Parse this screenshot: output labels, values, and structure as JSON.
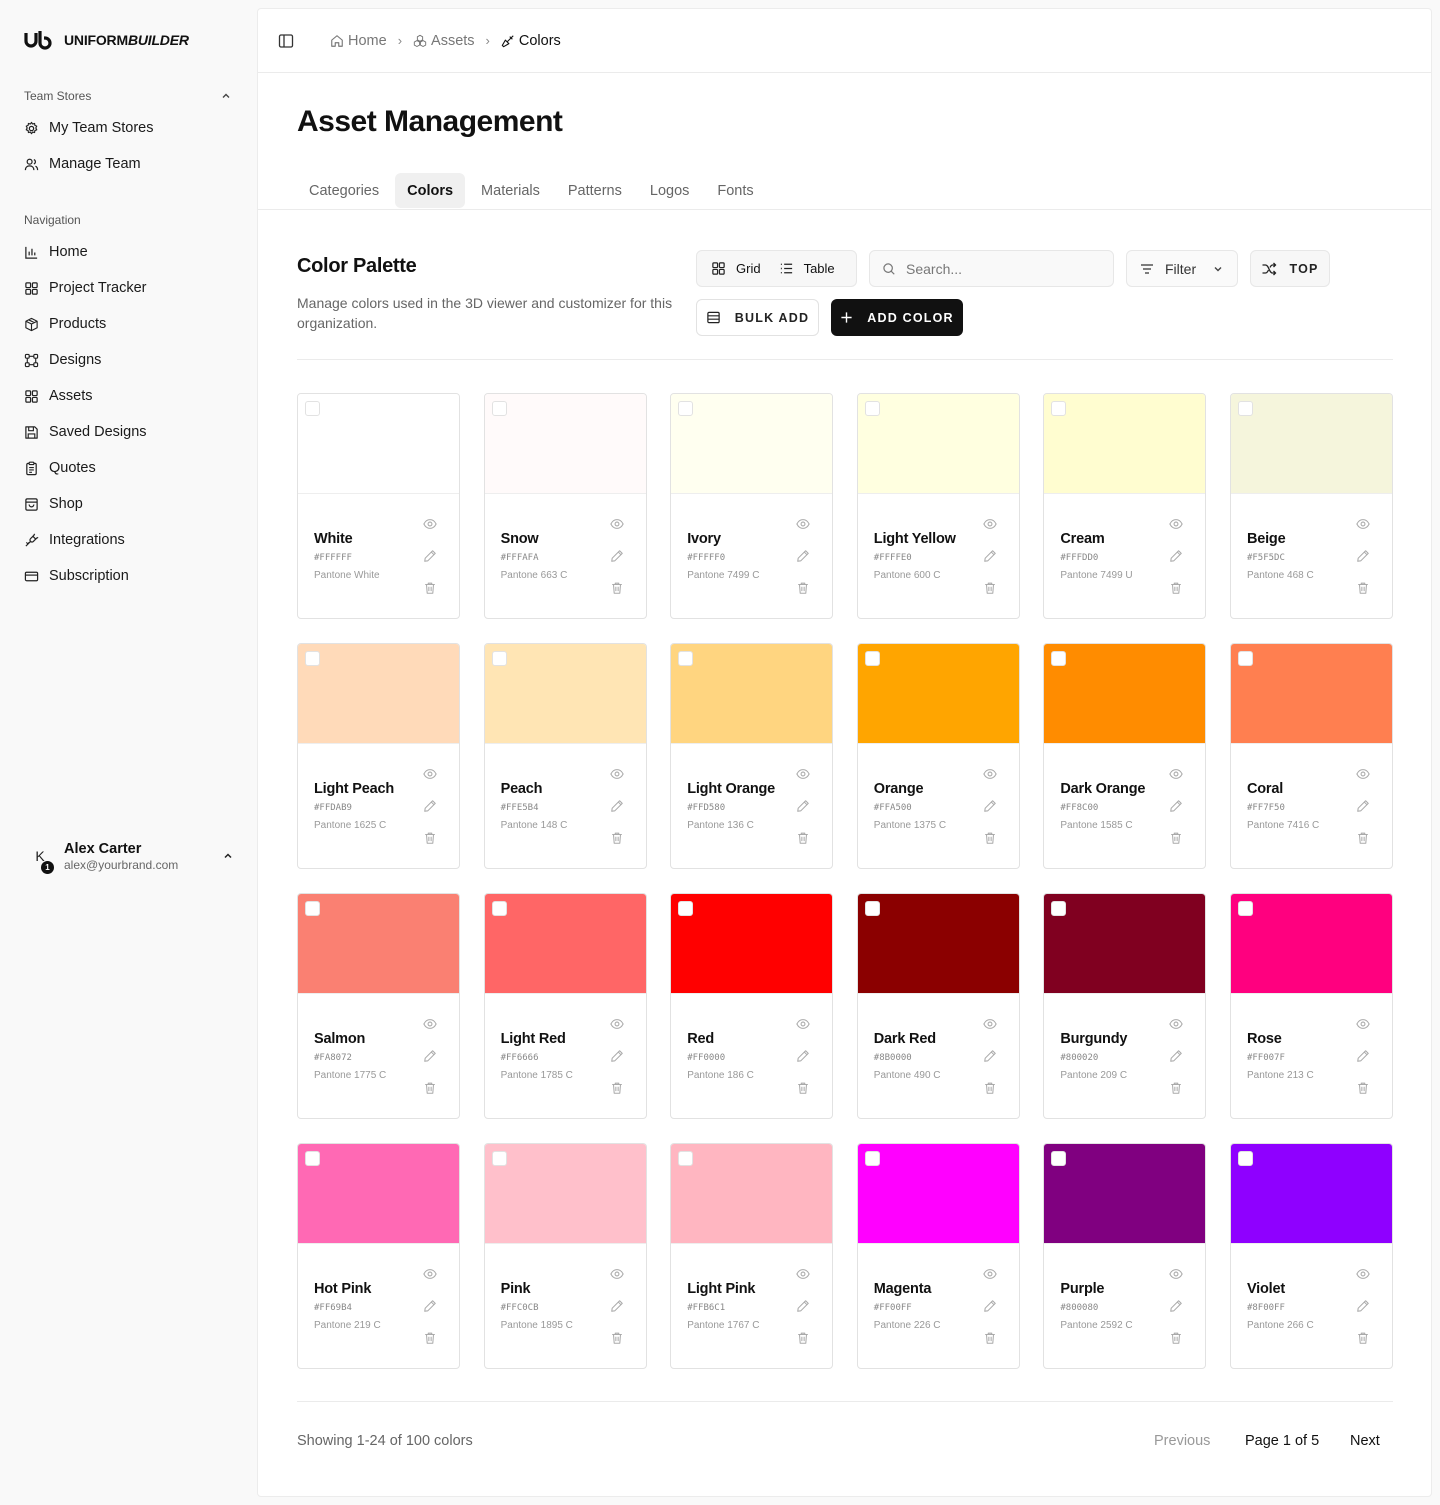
{
  "brand": {
    "logo_text_a": "UNIFORM",
    "logo_text_b": "BUILDER"
  },
  "sidebar": {
    "team_group": "Team Stores",
    "team_items": [
      {
        "label": "My Team Stores",
        "icon": "gear-icon"
      },
      {
        "label": "Manage Team",
        "icon": "users-icon"
      }
    ],
    "nav_group": "Navigation",
    "nav_items": [
      {
        "label": "Home",
        "icon": "chart-icon"
      },
      {
        "label": "Project Tracker",
        "icon": "grid-icon"
      },
      {
        "label": "Products",
        "icon": "box-icon"
      },
      {
        "label": "Designs",
        "icon": "nodes-icon"
      },
      {
        "label": "Assets",
        "icon": "grid-icon"
      },
      {
        "label": "Saved Designs",
        "icon": "save-icon"
      },
      {
        "label": "Quotes",
        "icon": "clipboard-icon"
      },
      {
        "label": "Shop",
        "icon": "shop-icon"
      },
      {
        "label": "Integrations",
        "icon": "plug-icon"
      },
      {
        "label": "Subscription",
        "icon": "card-icon"
      }
    ]
  },
  "user": {
    "initial": "K",
    "badge": "1",
    "name": "Alex Carter",
    "email": "alex@yourbrand.com"
  },
  "breadcrumb": {
    "home": "Home",
    "assets": "Assets",
    "colors": "Colors"
  },
  "page": {
    "title": "Asset Management"
  },
  "tabs": [
    {
      "label": "Categories",
      "active": false
    },
    {
      "label": "Colors",
      "active": true
    },
    {
      "label": "Materials",
      "active": false
    },
    {
      "label": "Patterns",
      "active": false
    },
    {
      "label": "Logos",
      "active": false
    },
    {
      "label": "Fonts",
      "active": false
    }
  ],
  "section": {
    "title": "Color Palette",
    "description": "Manage colors used in the 3D viewer and customizer for this organization."
  },
  "toolbar": {
    "grid_label": "Grid",
    "table_label": "Table",
    "search_placeholder": "Search...",
    "filter_label": "Filter",
    "top_label": "TOP",
    "bulk_label": "BULK ADD",
    "add_label": "ADD COLOR"
  },
  "colors": [
    {
      "name": "White",
      "hex": "#FFFFFF",
      "pantone": "Pantone White"
    },
    {
      "name": "Snow",
      "hex": "#FFFAFA",
      "pantone": "Pantone 663 C"
    },
    {
      "name": "Ivory",
      "hex": "#FFFFF0",
      "pantone": "Pantone 7499 C"
    },
    {
      "name": "Light Yellow",
      "hex": "#FFFFE0",
      "pantone": "Pantone 600 C"
    },
    {
      "name": "Cream",
      "hex": "#FFFDD0",
      "pantone": "Pantone 7499 U"
    },
    {
      "name": "Beige",
      "hex": "#F5F5DC",
      "pantone": "Pantone 468 C"
    },
    {
      "name": "Light Peach",
      "hex": "#FFDAB9",
      "pantone": "Pantone 1625 C"
    },
    {
      "name": "Peach",
      "hex": "#FFE5B4",
      "pantone": "Pantone 148 C"
    },
    {
      "name": "Light Orange",
      "hex": "#FFD580",
      "pantone": "Pantone 136 C"
    },
    {
      "name": "Orange",
      "hex": "#FFA500",
      "pantone": "Pantone 1375 C"
    },
    {
      "name": "Dark Orange",
      "hex": "#FF8C00",
      "pantone": "Pantone 1585 C"
    },
    {
      "name": "Coral",
      "hex": "#FF7F50",
      "pantone": "Pantone 7416 C"
    },
    {
      "name": "Salmon",
      "hex": "#FA8072",
      "pantone": "Pantone 1775 C"
    },
    {
      "name": "Light Red",
      "hex": "#FF6666",
      "pantone": "Pantone 1785 C"
    },
    {
      "name": "Red",
      "hex": "#FF0000",
      "pantone": "Pantone 186 C"
    },
    {
      "name": "Dark Red",
      "hex": "#8B0000",
      "pantone": "Pantone 490 C"
    },
    {
      "name": "Burgundy",
      "hex": "#800020",
      "pantone": "Pantone 209 C"
    },
    {
      "name": "Rose",
      "hex": "#FF007F",
      "pantone": "Pantone 213 C"
    },
    {
      "name": "Hot Pink",
      "hex": "#FF69B4",
      "pantone": "Pantone 219 C"
    },
    {
      "name": "Pink",
      "hex": "#FFC0CB",
      "pantone": "Pantone 1895 C"
    },
    {
      "name": "Light Pink",
      "hex": "#FFB6C1",
      "pantone": "Pantone 1767 C"
    },
    {
      "name": "Magenta",
      "hex": "#FF00FF",
      "pantone": "Pantone 226 C"
    },
    {
      "name": "Purple",
      "hex": "#800080",
      "pantone": "Pantone 2592 C"
    },
    {
      "name": "Violet",
      "hex": "#8F00FF",
      "pantone": "Pantone 266 C"
    }
  ],
  "pagination": {
    "showing": "Showing 1-24 of 100 colors",
    "previous": "Previous",
    "page_info": "Page 1 of 5",
    "next": "Next"
  }
}
